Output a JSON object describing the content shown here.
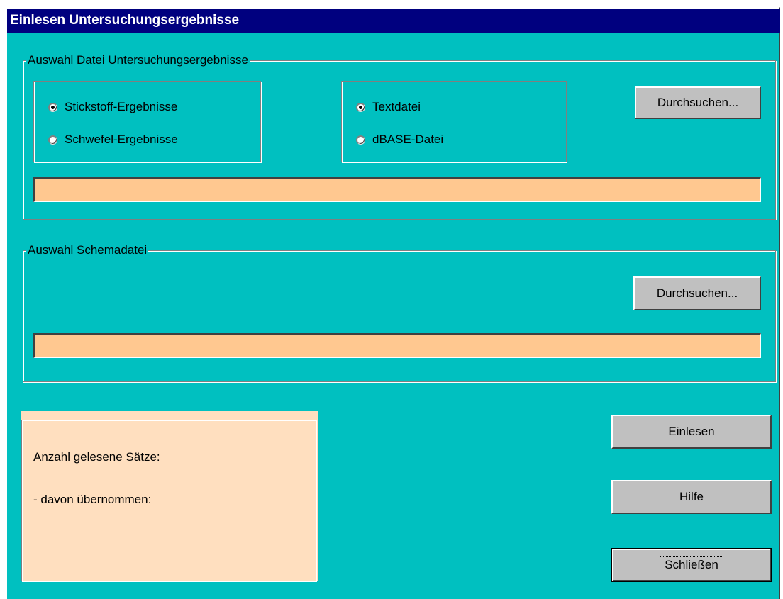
{
  "window": {
    "title": "Einlesen Untersuchungsergebnisse"
  },
  "group_results": {
    "legend": "Auswahl Datei Untersuchungsergebnisse",
    "type_options": [
      {
        "label": "Stickstoff-Ergebnisse",
        "checked": true
      },
      {
        "label": "Schwefel-Ergebnisse",
        "checked": false
      }
    ],
    "format_options": [
      {
        "label": "Textdatei",
        "checked": true
      },
      {
        "label": "dBASE-Datei",
        "checked": false
      }
    ],
    "browse_label": "Durchsuchen...",
    "file_path_value": ""
  },
  "group_schema": {
    "legend": "Auswahl Schemadatei",
    "browse_label": "Durchsuchen...",
    "file_path_value": ""
  },
  "stats": {
    "read_label": "Anzahl gelesene Sätze:",
    "accepted_label": "- davon übernommen:"
  },
  "actions": {
    "import_label": "Einlesen",
    "help_label": "Hilfe",
    "close_label": "Schließen"
  },
  "colors": {
    "background": "#00c0c0",
    "titlebar": "#00007f",
    "field": "#ffc890",
    "stats_panel": "#ffdfbf"
  }
}
